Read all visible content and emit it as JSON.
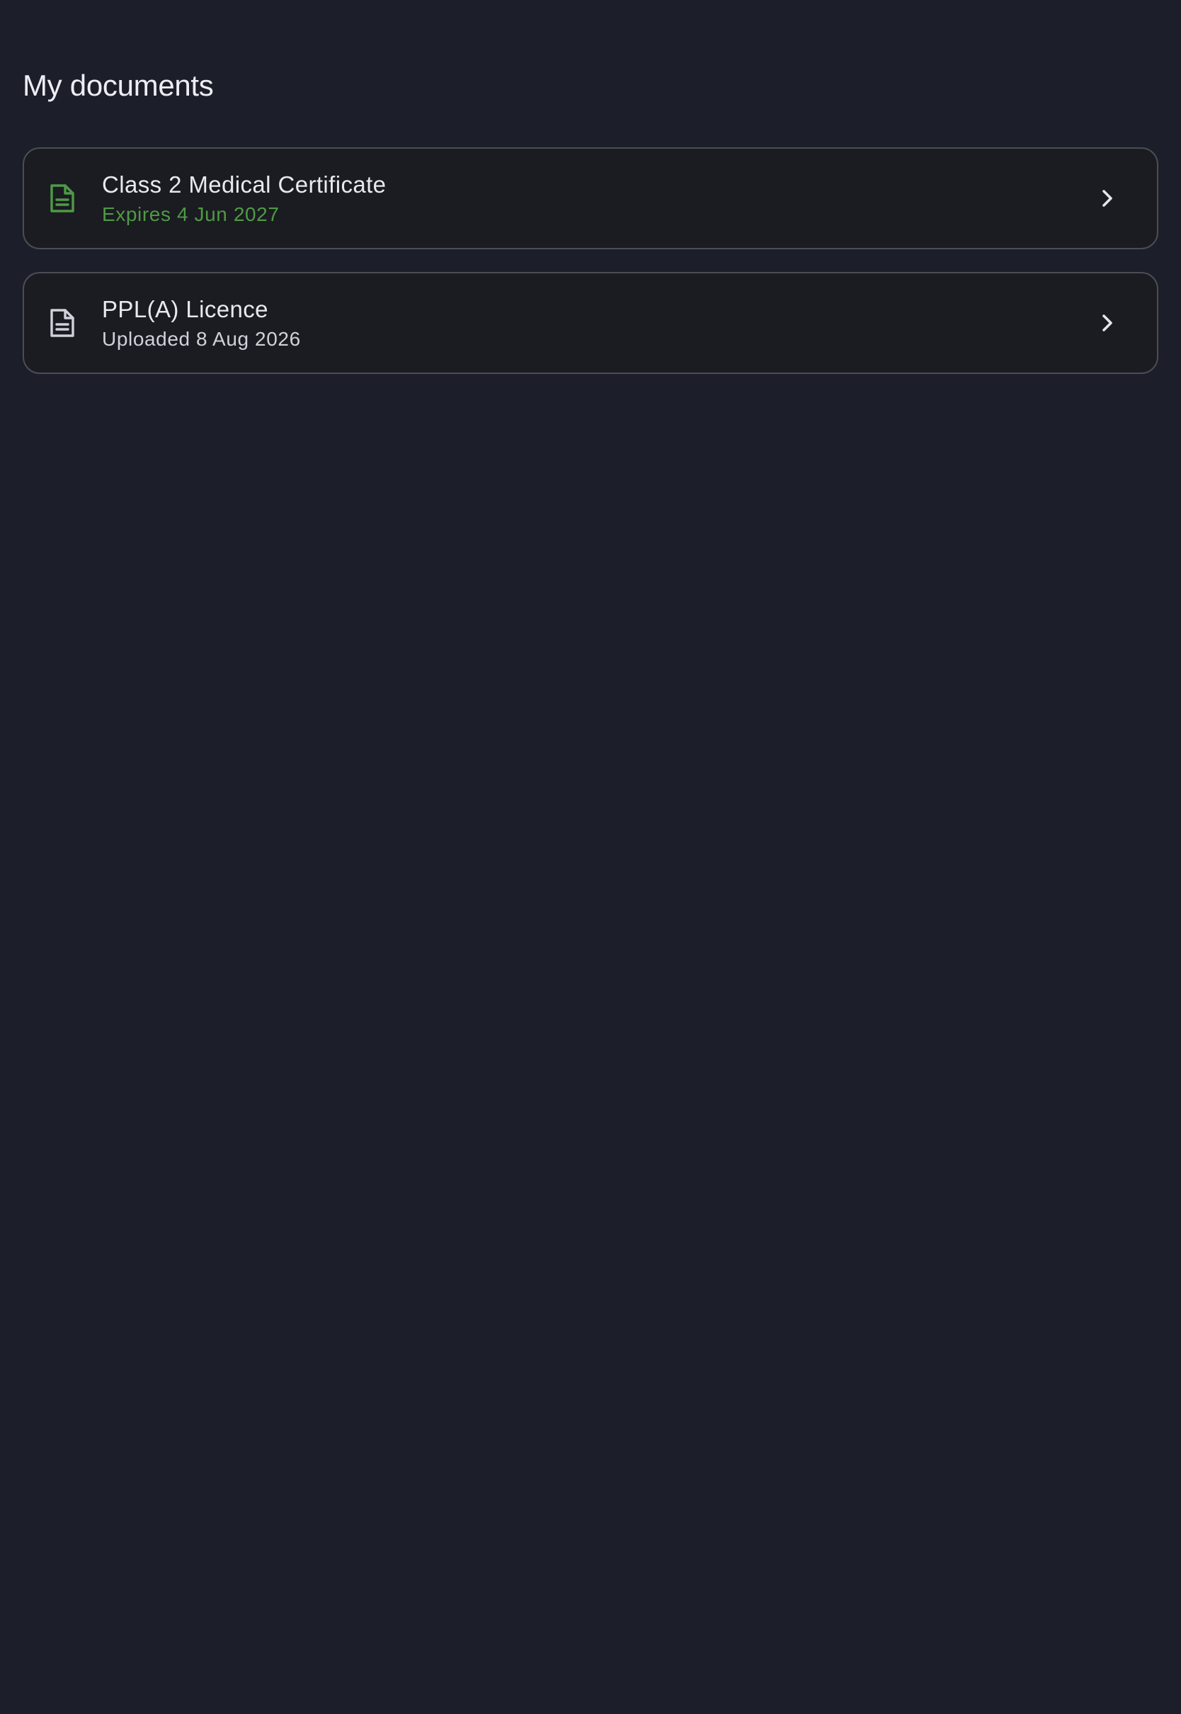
{
  "header": {
    "title": "My documents"
  },
  "documents": [
    {
      "title": "Class 2 Medical Certificate",
      "subtitle": "Expires 4 Jun 2027",
      "icon": "document-icon",
      "icon_color": "#4f9a45",
      "subtitle_color": "#4f9a45"
    },
    {
      "title": "PPL(A) Licence",
      "subtitle": "Uploaded 8 Aug 2026",
      "icon": "document-icon",
      "icon_color": "#cfd2da",
      "subtitle_color": "#cfd2da"
    }
  ],
  "colors": {
    "background": "#1c1f29",
    "card_background": "#1a1c21",
    "card_border": "#4a4d55",
    "valid": "#4f9a45"
  }
}
